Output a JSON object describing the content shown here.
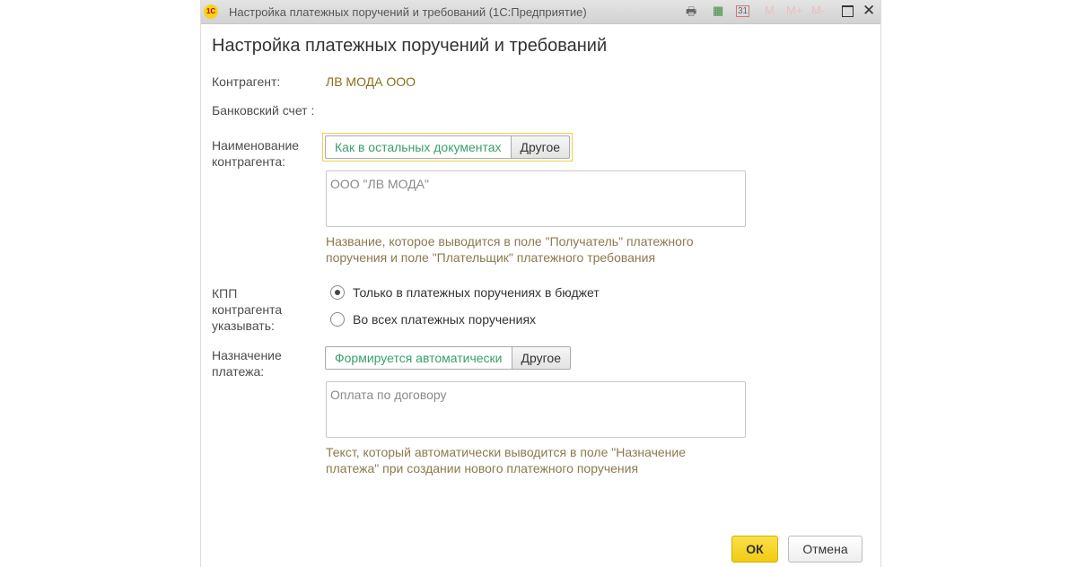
{
  "window": {
    "title": "Настройка платежных поручений и требований  (1С:Предприятие)",
    "logo": "1С",
    "toolbar": [
      "print-icon",
      "calculator-icon",
      "calendar-icon",
      "M",
      "M+",
      "M-",
      "maximize-icon",
      "close-icon"
    ],
    "calendar_day": "31"
  },
  "form": {
    "title": "Настройка платежных поручений и требований",
    "counterparty_label": "Контрагент:",
    "counterparty_value": "ЛВ МОДА ООО",
    "bank_label": "Банковский счет :",
    "name_label": "Наименование контрагента:",
    "name_switch": {
      "option1": "Как в остальных документах",
      "option2": "Другое",
      "selected": "Как в остальных документах"
    },
    "name_value": "ООО \"ЛВ МОДА\"",
    "name_hint": "Название, которое выводится в поле \"Получатель\" платежного поручения и поле \"Плательщик\" платежного требования",
    "kpp_label": "КПП контрагента указывать:",
    "kpp_options": [
      "Только в платежных поручениях в бюджет",
      "Во всех платежных поручениях"
    ],
    "kpp_selected": 0,
    "purpose_label": "Назначение платежа:",
    "purpose_switch": {
      "option1": "Формируется автоматически",
      "option2": "Другое",
      "selected": "Формируется автоматически"
    },
    "purpose_value": "Оплата по договору",
    "purpose_hint": "Текст, который автоматически выводится в поле \"Назначение платежа\" при создании нового платежного поручения",
    "ok": "ОК",
    "cancel": "Отмена"
  },
  "colors": {
    "accent": "#f7d317",
    "link": "#3aa06a",
    "value": "#8a6d1c"
  }
}
